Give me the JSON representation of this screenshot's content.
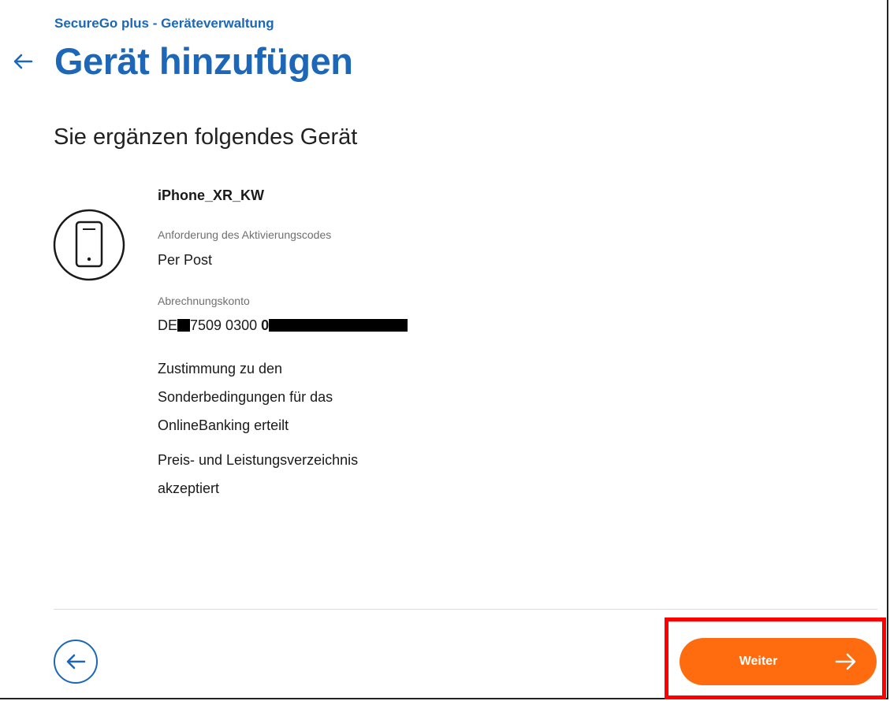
{
  "header": {
    "app_subtitle": "SecureGo plus - Geräteverwaltung",
    "page_title": "Gerät hinzufügen"
  },
  "main": {
    "section_heading": "Sie ergänzen folgendes Gerät",
    "device": {
      "name": "iPhone_XR_KW",
      "icon": "smartphone-icon"
    },
    "activation_code": {
      "label": "Anforderung des Aktivierungscodes",
      "value": "Per Post"
    },
    "billing_account": {
      "label": "Abrechnungskonto",
      "prefix": "DE",
      "middle": "7509 0300",
      "suffix": "0"
    },
    "consent_terms": [
      "Zustimmung zu den",
      "Sonderbedingungen für das",
      "OnlineBanking erteilt"
    ],
    "consent_prices": [
      "Preis- und Leistungsverzeichnis",
      "akzeptiert"
    ]
  },
  "footer": {
    "back_icon": "arrow-left-icon",
    "next_label": "Weiter",
    "next_icon": "arrow-right-icon"
  },
  "colors": {
    "brand_blue": "#1c67b8",
    "accent_orange": "#ff6b0f",
    "highlight_red": "#ff0000"
  }
}
